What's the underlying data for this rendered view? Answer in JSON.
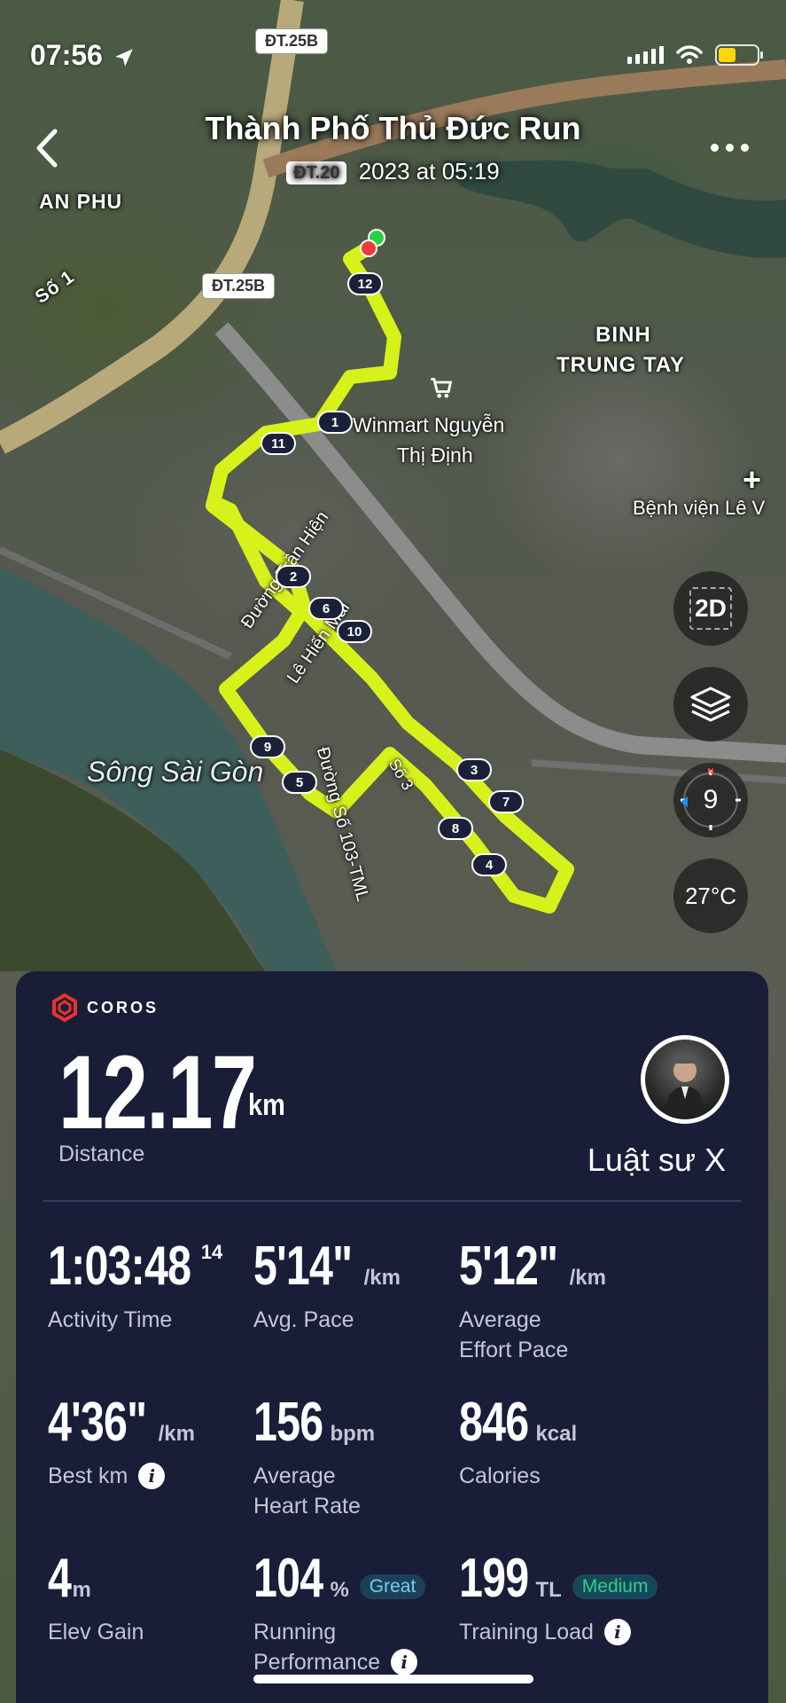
{
  "status_bar": {
    "time": "07:56"
  },
  "header": {
    "title": "Thành Phố Thủ Đức Run",
    "subtitle_date": "2023 at 05:19",
    "subtitle_prefix": "ĐT.20"
  },
  "map": {
    "labels": {
      "an_phu": "AN PHU",
      "so_1": "Số 1",
      "binh_trung_tay_1": "BINH",
      "binh_trung_tay_2": "TRUNG TAY",
      "winmart_1": "Winmart Nguyễn",
      "winmart_2": "Thị Định",
      "hospital": "Bệnh viện Lê V",
      "river": "Sông Sài Gòn",
      "street_1": "Đường Trần Hiện",
      "street_2": "Lê Hiến Mai",
      "street_3": "Đường Số 103-TML",
      "street_4": "Số 3"
    },
    "road_badges": [
      "ĐT.25B",
      "ĐT.25B"
    ],
    "km_markers": [
      "1",
      "2",
      "3",
      "4",
      "5",
      "6",
      "7",
      "8",
      "9",
      "10",
      "11",
      "12"
    ],
    "buttons": {
      "view_mode": "2D",
      "compass_value": "9",
      "temperature": "27°C"
    },
    "route_color": "#d7f21a"
  },
  "stats": {
    "brand": "COROS",
    "distance": {
      "value": "12.17",
      "unit": "km",
      "label": "Distance"
    },
    "user_name": "Luật sư X",
    "metrics": [
      {
        "value": "1:03:48",
        "sup": "14",
        "unit": "",
        "label": "Activity Time"
      },
      {
        "value": "5'14\"",
        "unit": "/km",
        "label": "Avg. Pace"
      },
      {
        "value": "5'12\"",
        "unit": "/km",
        "label_1": "Average",
        "label_2": "Effort Pace"
      },
      {
        "value": "4'36\"",
        "unit": "/km",
        "label": "Best km"
      },
      {
        "value": "156",
        "unit": "bpm",
        "label_1": "Average",
        "label_2": "Heart Rate"
      },
      {
        "value": "846",
        "unit": "kcal",
        "label": "Calories"
      },
      {
        "value": "4",
        "unit": "m",
        "label": "Elev Gain"
      },
      {
        "value": "104",
        "unit": "%",
        "badge": "Great",
        "label_1": "Running",
        "label_2": "Performance"
      },
      {
        "value": "199",
        "unit": "TL",
        "badge": "Medium",
        "label": "Training Load"
      }
    ]
  }
}
